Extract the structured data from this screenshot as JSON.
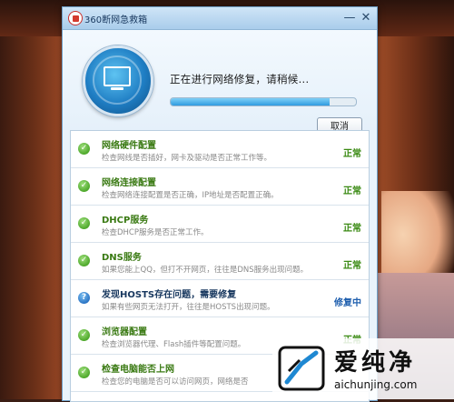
{
  "window": {
    "title": "360断网急救箱",
    "controls": [
      "—",
      "✕"
    ]
  },
  "header": {
    "status": "正在进行网络修复，请稍候...",
    "progress": 0.86,
    "cancel_label": "取消"
  },
  "items": [
    {
      "title": "网络硬件配置",
      "desc": "检查网线是否插好，网卡及驱动是否正常工作等。",
      "status": "正常",
      "state": "ok"
    },
    {
      "title": "网络连接配置",
      "desc": "检查网络连接配置是否正确，IP地址是否配置正确。",
      "status": "正常",
      "state": "ok"
    },
    {
      "title": "DHCP服务",
      "desc": "检查DHCP服务是否正常工作。",
      "status": "正常",
      "state": "ok"
    },
    {
      "title": "DNS服务",
      "desc": "如果您能上QQ，但打不开网页，往往是DNS服务出现问题。",
      "status": "正常",
      "state": "ok"
    },
    {
      "title": "发现HOSTS存在问题，需要修复",
      "desc": "如果有些网页无法打开，往往是HOSTS出现问题。",
      "status": "修复中",
      "state": "fixing"
    },
    {
      "title": "浏览器配置",
      "desc": "检查浏览器代理、Flash插件等配置问题。",
      "status": "正常",
      "state": "ok"
    },
    {
      "title": "检查电脑能否上网",
      "desc": "检查您的电脑是否可以访问网页，网络是否",
      "status": "",
      "state": "ok"
    }
  ],
  "watermark": {
    "brand_cn": "爱纯净",
    "domain": "aichunjing.com"
  },
  "colors": {
    "ok_text": "#3a7a13",
    "fixing_text": "#1f5fae",
    "accent": "#2f9be0"
  }
}
